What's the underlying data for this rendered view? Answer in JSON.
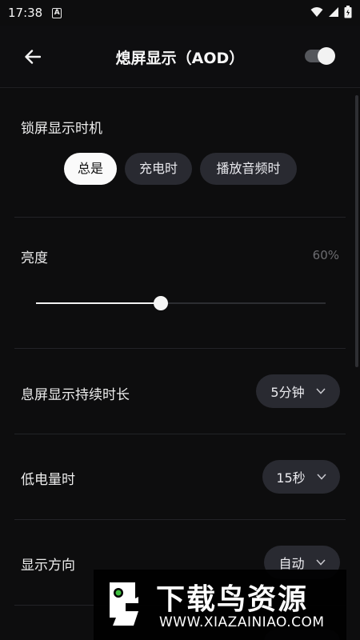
{
  "status_bar": {
    "time": "17:38",
    "notification_glyph": "A"
  },
  "app_bar": {
    "title": "熄屏显示（AOD）",
    "master_toggle_on": true
  },
  "display_timing": {
    "label": "锁屏显示时机",
    "options": [
      {
        "label": "总是",
        "selected": true
      },
      {
        "label": "充电时",
        "selected": false
      },
      {
        "label": "播放音频时",
        "selected": false
      }
    ]
  },
  "brightness": {
    "label": "亮度",
    "value_text": "60%",
    "value_fraction": 0.43
  },
  "display_duration": {
    "label": "息屏显示持续时长",
    "value": "5分钟"
  },
  "low_battery": {
    "label": "低电量时",
    "value": "15秒"
  },
  "orientation": {
    "label": "显示方向",
    "value": "自动"
  },
  "watermark": {
    "title": "下载鸟资源",
    "url": "WWW.XIAZAINIAO.COM"
  },
  "colors": {
    "background": "#0d0d0e",
    "chip": "#292a31",
    "chip_active": "#fafafa"
  }
}
